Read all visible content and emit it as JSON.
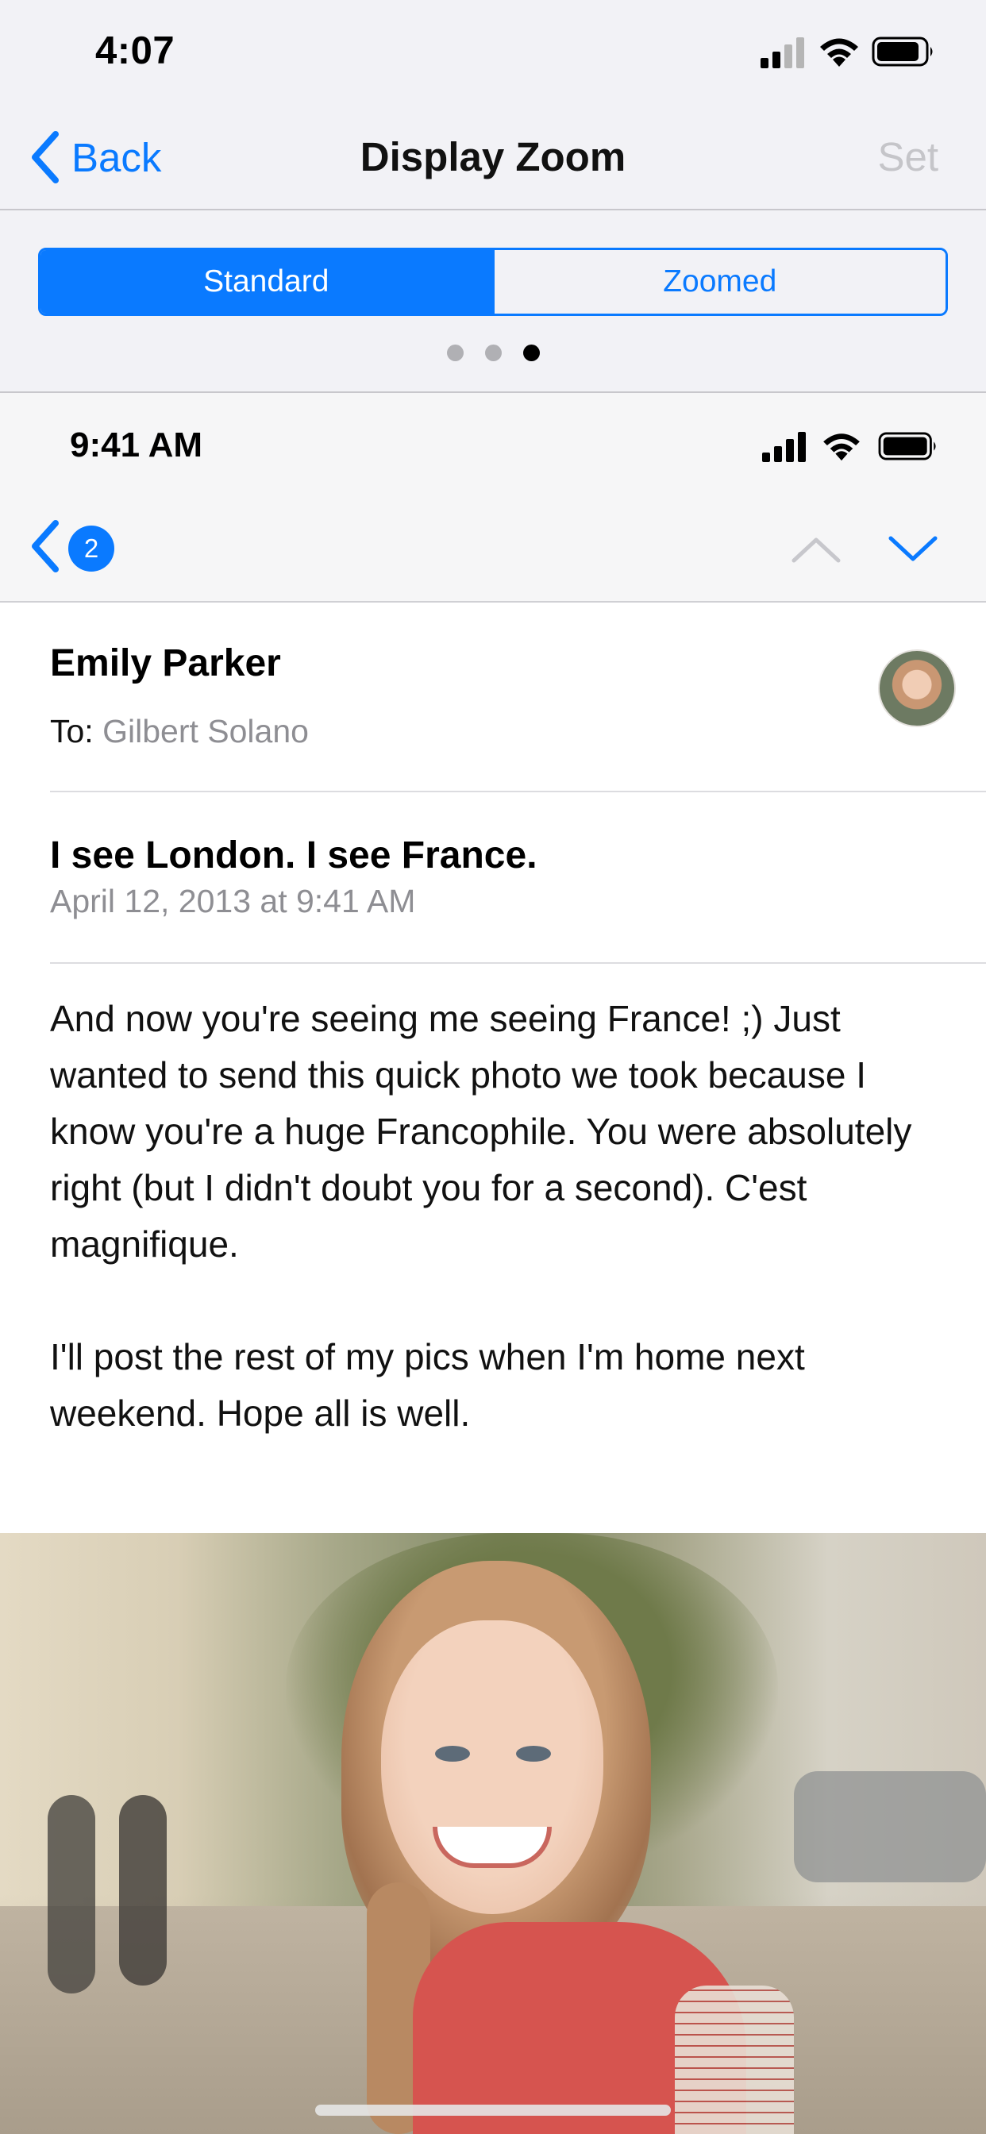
{
  "status_bar": {
    "time": "4:07",
    "icons": [
      "cellular-signal-icon",
      "wifi-icon",
      "battery-icon"
    ]
  },
  "nav": {
    "back_label": "Back",
    "title": "Display Zoom",
    "set_label": "Set"
  },
  "segmented": {
    "options": [
      "Standard",
      "Zoomed"
    ],
    "selected": "Standard"
  },
  "page_dots": {
    "count": 3,
    "current": 3
  },
  "preview": {
    "status_time": "9:41 AM",
    "back_count": "2",
    "icons": [
      "chevron-left-icon",
      "chevron-up-icon",
      "chevron-down-icon"
    ],
    "mail": {
      "sender": "Emily Parker",
      "to_label": "To:",
      "to_name": "Gilbert Solano",
      "subject": "I see London. I see France.",
      "date": "April 12, 2013 at 9:41 AM",
      "body": [
        "And now you're seeing me seeing France! ;) Just wanted to send this quick photo we took because I know you're a huge Francophile. You were absolutely right (but I didn't doubt you for a second). C'est magnifique.",
        "I'll post the rest of my pics when I'm home next weekend. Hope all is well."
      ]
    }
  },
  "colors": {
    "accent": "#0a7aff",
    "header_bg": "#f2f2f6",
    "secondary_text": "#8e8e93",
    "disabled_text": "#c5c5c9"
  }
}
